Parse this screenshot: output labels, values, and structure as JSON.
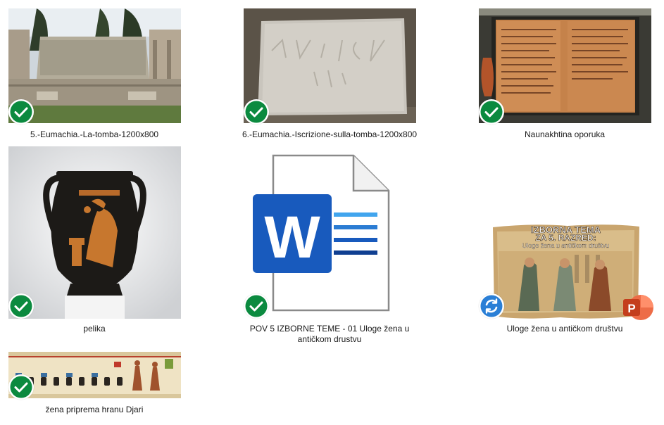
{
  "colors": {
    "synced_green": "#0b8a3f",
    "sync_blue": "#2a7fd6",
    "word_blue": "#185abd",
    "ppt_red": "#d24726"
  },
  "files": [
    {
      "name": "5.-Eumachia.-La-tomba-1200x800",
      "status": "synced",
      "status_icon": "check-icon"
    },
    {
      "name": "6.-Eumachia.-Iscrizione-sulla-tomba-1200x800",
      "status": "synced",
      "status_icon": "check-icon"
    },
    {
      "name": "Naunakhtina oporuka",
      "status": "synced",
      "status_icon": "check-icon"
    },
    {
      "name": "pelika",
      "status": "synced",
      "status_icon": "check-icon"
    },
    {
      "name_line1": "POV 5 IZBORNE TEME - 01 Uloge žena u",
      "name_line2": "antičkom drustvu",
      "type_icon": "word-icon",
      "status": "synced",
      "status_icon": "check-icon"
    },
    {
      "name": "Uloge žena u antičkom društvu",
      "type_icon": "powerpoint-icon",
      "status": "syncing",
      "status_icon": "sync-icon",
      "slide_title_1": "IZBORNA TEMA",
      "slide_title_2": "ZA 5. RAZRED:",
      "slide_subtitle": "Uloge žena u antičkom društvu"
    },
    {
      "name": "žena priprema hranu Djari",
      "status": "synced",
      "status_icon": "check-icon"
    }
  ]
}
